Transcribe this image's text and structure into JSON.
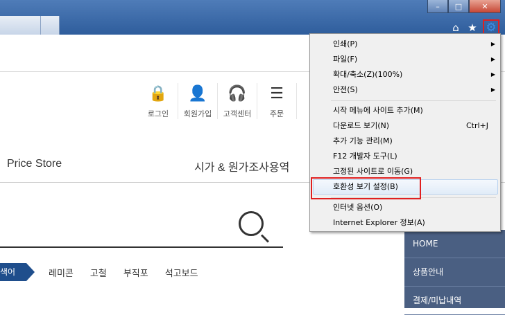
{
  "window": {
    "minimize_icon": "minimize-icon",
    "maximize_icon": "maximize-icon",
    "close_icon": "close-icon",
    "minimize_glyph": "–",
    "maximize_glyph": "□",
    "close_glyph": "✕"
  },
  "toolbar": {
    "home_glyph": "⌂",
    "favorites_glyph": "★",
    "tools_glyph": "⚙",
    "accent": "#3a8ee8",
    "highlight_color": "#e02020"
  },
  "site": {
    "nav": [
      {
        "icon": "lock-icon",
        "glyph": "🔒",
        "label": "로그인"
      },
      {
        "icon": "user-icon",
        "glyph": "👤",
        "label": "회원가입"
      },
      {
        "icon": "headset-icon",
        "glyph": "🎧",
        "label": "고객센터"
      },
      {
        "icon": "list-icon",
        "glyph": "☰",
        "label": "주문"
      }
    ],
    "price_store": "Price Store",
    "menu_text": "시가 & 원가조사용역",
    "category_tag": "색어",
    "categories": [
      "레미콘",
      "고철",
      "부직포",
      "석고보드"
    ],
    "side_menu": [
      "HOME",
      "상품안내",
      "결제/미납내역"
    ]
  },
  "menu": {
    "items": [
      {
        "label": "인쇄(P)",
        "submenu": true
      },
      {
        "label": "파일(F)",
        "submenu": true
      },
      {
        "label": "확대/축소(Z)(100%)",
        "submenu": true
      },
      {
        "label": "안전(S)",
        "submenu": true
      },
      {
        "label": "시작 메뉴에 사이트 추가(M)",
        "submenu": false
      },
      {
        "label": "다운로드 보기(N)",
        "shortcut": "Ctrl+J"
      },
      {
        "label": "추가 기능 관리(M)",
        "submenu": false
      },
      {
        "label": "F12 개발자 도구(L)",
        "submenu": false
      },
      {
        "label": "고정된 사이트로 이동(G)",
        "submenu": false
      },
      {
        "label": "호환성 보기 설정(B)",
        "submenu": false,
        "highlighted": true
      },
      {
        "label": "인터넷 옵션(O)",
        "submenu": false
      },
      {
        "label": "Internet Explorer 정보(A)",
        "submenu": false
      }
    ],
    "submenu_glyph": "▶"
  }
}
